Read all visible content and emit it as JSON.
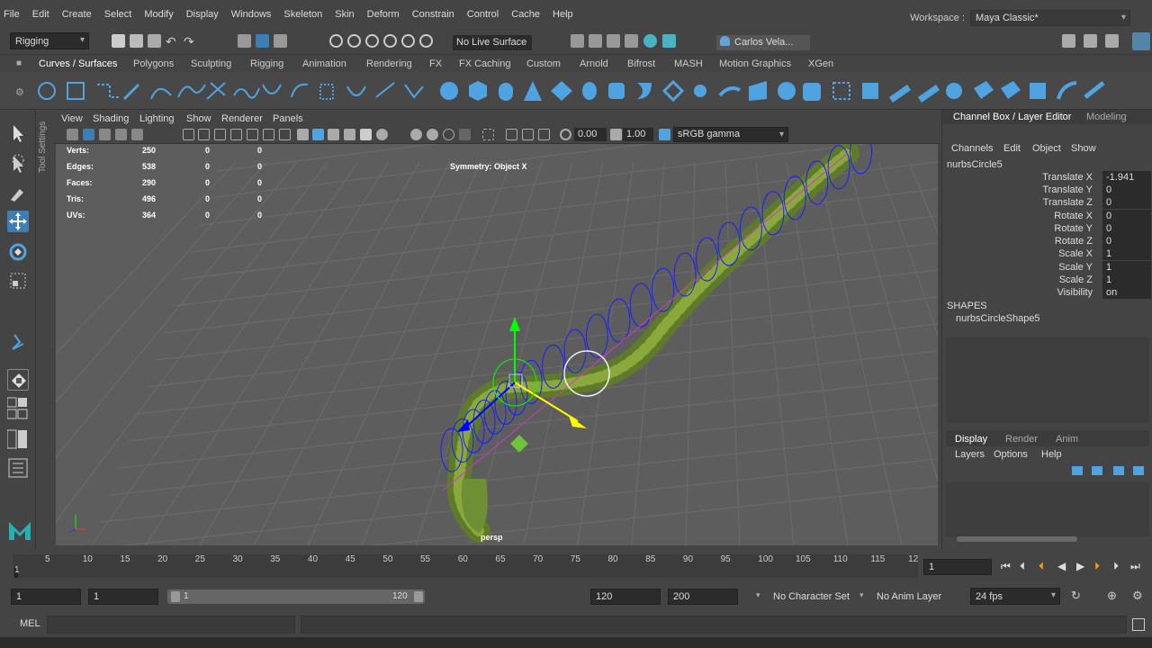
{
  "menu": [
    "File",
    "Edit",
    "Create",
    "Select",
    "Modify",
    "Display",
    "Windows",
    "Skeleton",
    "Skin",
    "Deform",
    "Constrain",
    "Control",
    "Cache",
    "Help"
  ],
  "workspace": {
    "label": "Workspace :",
    "value": "Maya Classic*"
  },
  "statusline": {
    "mode": "Rigging",
    "live_surface": "No Live Surface",
    "user": "Carlos Vela..."
  },
  "shelf_tabs": [
    "Curves / Surfaces",
    "Polygons",
    "Sculpting",
    "Rigging",
    "Animation",
    "Rendering",
    "FX",
    "FX Caching",
    "Custom",
    "Arnold",
    "Bifrost",
    "MASH",
    "Motion Graphics",
    "XGen"
  ],
  "tool_settings_label": "Tool Settings",
  "panel_menu": [
    "View",
    "Shading",
    "Lighting",
    "Show",
    "Renderer",
    "Panels"
  ],
  "panel_toolbar": {
    "exposure": "0.00",
    "gamma": "1.00",
    "colorspace": "sRGB gamma"
  },
  "hud": {
    "rows": [
      {
        "label": "Verts:",
        "a": "250",
        "b": "0",
        "c": "0"
      },
      {
        "label": "Edges:",
        "a": "538",
        "b": "0",
        "c": "0"
      },
      {
        "label": "Faces:",
        "a": "290",
        "b": "0",
        "c": "0"
      },
      {
        "label": "Tris:",
        "a": "496",
        "b": "0",
        "c": "0"
      },
      {
        "label": "UVs:",
        "a": "364",
        "b": "0",
        "c": "0"
      }
    ],
    "symmetry": "Symmetry: Object X",
    "camera": "persp"
  },
  "channel_box": {
    "tab_main": "Channel Box / Layer Editor",
    "tab_modeling": "Modeling",
    "menus": [
      "Channels",
      "Edit",
      "Object",
      "Show"
    ],
    "object": "nurbsCircle5",
    "attributes": [
      {
        "name": "Translate X",
        "value": "-1.941"
      },
      {
        "name": "Translate Y",
        "value": "0"
      },
      {
        "name": "Translate Z",
        "value": "0"
      },
      {
        "name": "Rotate X",
        "value": "0"
      },
      {
        "name": "Rotate Y",
        "value": "0"
      },
      {
        "name": "Rotate Z",
        "value": "0"
      },
      {
        "name": "Scale X",
        "value": "1"
      },
      {
        "name": "Scale Y",
        "value": "1"
      },
      {
        "name": "Scale Z",
        "value": "1"
      },
      {
        "name": "Visibility",
        "value": "on"
      }
    ],
    "shapes_header": "SHAPES",
    "shape_name": "nurbsCircleShape5",
    "layer_tabs": [
      "Display",
      "Render",
      "Anim"
    ],
    "layer_menus": [
      "Layers",
      "Options",
      "Help"
    ]
  },
  "timeline": {
    "ticks": [
      "1",
      "5",
      "10",
      "15",
      "20",
      "25",
      "30",
      "35",
      "40",
      "45",
      "50",
      "55",
      "60",
      "65",
      "70",
      "75",
      "80",
      "85",
      "90",
      "95",
      "100",
      "105",
      "110",
      "115",
      "12"
    ],
    "current_frame": "1"
  },
  "range": {
    "start": "1",
    "anim_start": "1",
    "range_start": "1",
    "range_end": "120",
    "end": "120",
    "anim_end": "200",
    "character_set": "No Character Set",
    "anim_layer": "No Anim Layer",
    "fps": "24 fps"
  },
  "cmdline": {
    "lang": "MEL"
  },
  "colors": {
    "accent": "#5285a6",
    "active_tool": "#3d7fb5",
    "viewport": "#5d5d5d"
  }
}
